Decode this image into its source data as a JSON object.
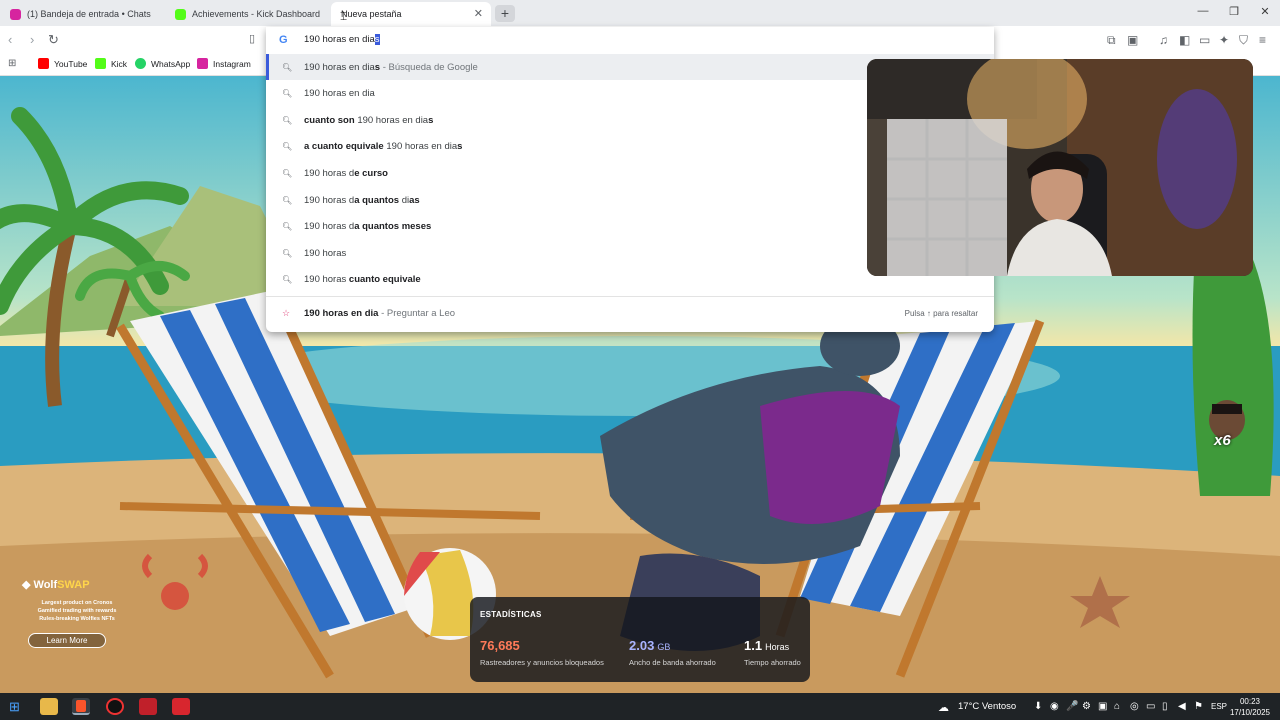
{
  "tabs": [
    {
      "title": "(1) Bandeja de entrada • Chats",
      "favicon": "instagram-icon",
      "color": "#d6249f"
    },
    {
      "title": "Achievements - Kick Dashboard",
      "favicon": "kick-icon",
      "color": "#53fc18"
    },
    {
      "title": "Nueva pestaña",
      "favicon": "none",
      "active": true
    }
  ],
  "omnibox": {
    "typed": "190 horas en dia",
    "autocomplete": "s",
    "suggestions": [
      {
        "parts": [
          {
            "t": "190 horas en dia",
            "b": false
          },
          {
            "t": "s",
            "b": true
          }
        ],
        "suffix": " - Búsqueda de Google",
        "highlight": true
      },
      {
        "parts": [
          {
            "t": "190 horas en dia",
            "b": false
          }
        ]
      },
      {
        "parts": [
          {
            "t": "cuanto son ",
            "b": true
          },
          {
            "t": "190 horas en dia",
            "b": false
          },
          {
            "t": "s",
            "b": true
          }
        ]
      },
      {
        "parts": [
          {
            "t": "a cuanto equivale ",
            "b": true
          },
          {
            "t": "190 horas en dia",
            "b": false
          },
          {
            "t": "s",
            "b": true
          }
        ]
      },
      {
        "parts": [
          {
            "t": "190 horas d",
            "b": false
          },
          {
            "t": "e curso",
            "b": true
          }
        ]
      },
      {
        "parts": [
          {
            "t": "190 horas d",
            "b": false
          },
          {
            "t": "a quantos ",
            "b": true
          },
          {
            "t": "di",
            "b": false
          },
          {
            "t": "as",
            "b": true
          }
        ]
      },
      {
        "parts": [
          {
            "t": "190 horas d",
            "b": false
          },
          {
            "t": "a quantos meses",
            "b": true
          }
        ]
      },
      {
        "parts": [
          {
            "t": "190 horas",
            "b": false
          }
        ]
      },
      {
        "parts": [
          {
            "t": "190 horas ",
            "b": false
          },
          {
            "t": "cuanto equivale",
            "b": true
          }
        ]
      }
    ],
    "leo": {
      "query": "190 horas en dia",
      "suffix": " - Preguntar a Leo",
      "hint": "Pulsa ↑ para resaltar"
    }
  },
  "bookmarks": [
    {
      "label": "YouTube",
      "color": "#ff0000"
    },
    {
      "label": "Kick",
      "color": "#53fc18"
    },
    {
      "label": "WhatsApp",
      "color": "#25d366"
    },
    {
      "label": "Instagram",
      "color": "#d6249f"
    }
  ],
  "ad": {
    "brand_a": "Wolf",
    "brand_b": "SWAP",
    "line1": "Largest product on Cronos",
    "line2": "Gamified trading with rewards",
    "line3": "Rules-breaking Wolfies NFTs",
    "button": "Learn More"
  },
  "stats": {
    "title": "ESTADÍSTICAS",
    "items": [
      {
        "value": "76,685",
        "unit": "",
        "label": "Rastreadores y anuncios bloqueados",
        "color": "#ff7a59"
      },
      {
        "value": "2.03",
        "unit": "GB",
        "label": "Ancho de banda ahorrado",
        "color": "#a9b4ff"
      },
      {
        "value": "1.1",
        "unit": "Horas",
        "label": "Tiempo ahorrado",
        "color": "#ffffff"
      }
    ]
  },
  "emote": {
    "text": "x6"
  },
  "taskbar": {
    "weather": "17°C Ventoso",
    "lang": "ESP",
    "time": "00:23",
    "date": "17/10/2025"
  }
}
